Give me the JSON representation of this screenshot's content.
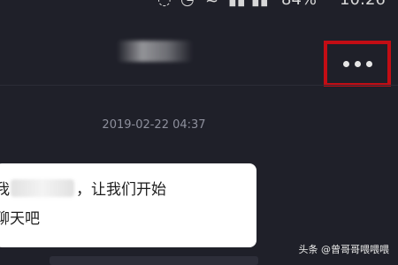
{
  "status_bar": {
    "battery": "84%",
    "time": "10:26"
  },
  "header": {
    "title": "",
    "menu_icon": "more-horizontal-icon"
  },
  "conversation": {
    "timestamp": "2019-02-22 04:37",
    "message_prefix": "我",
    "message_suffix": "，让我们开始",
    "message_line_2": "聊天吧"
  },
  "watermark": {
    "text": "头条 @曾哥哥喂喂喂"
  },
  "colors": {
    "background": "#1f2029",
    "highlight_border": "#c30d14",
    "bubble": "#ffffff",
    "timestamp_text": "#8d8f9c"
  }
}
